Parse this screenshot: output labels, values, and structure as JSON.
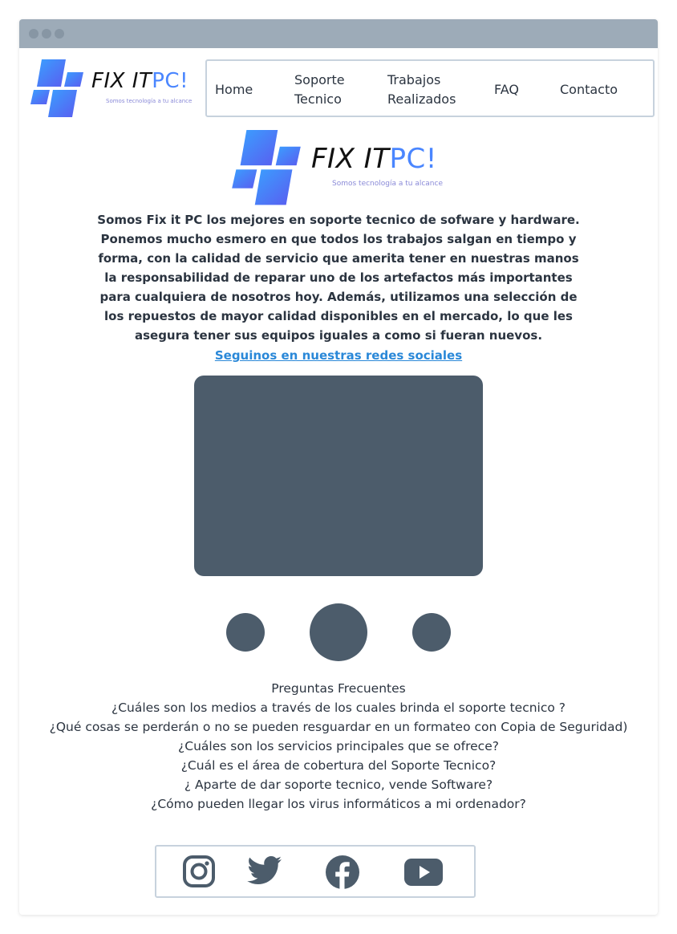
{
  "brand": {
    "name_main": "FIX IT",
    "name_accent": "PC!",
    "tagline": "Somos tecnología a tu alcance"
  },
  "nav": {
    "items": [
      {
        "label": "Home"
      },
      {
        "label": "Soporte\nTecnico"
      },
      {
        "label": "Trabajos\nRealizados"
      },
      {
        "label": "FAQ"
      },
      {
        "label": "Contacto"
      }
    ]
  },
  "about": {
    "text": "Somos Fix it PC los mejores en soporte tecnico de sofware y hardware. Ponemos mucho esmero en que todos los trabajos salgan en tiempo y forma, con la calidad de servicio que amerita tener en nuestras manos la responsabilidad de reparar uno de los artefactos más importantes para cualquiera de nosotros hoy. Además, utilizamos una selección de los repuestos de mayor calidad disponibles en el mercado, lo que les asegura tener sus equipos iguales a como si fueran nuevos.",
    "social_link": "Seguinos en nuestras redes sociales"
  },
  "faq": {
    "title": "Preguntas Frecuentes",
    "questions": [
      "¿Cuáles son los medios a través de los cuales brinda el soporte tecnico ?",
      "¿Qué cosas se perderán o no se pueden resguardar en un formateo con Copia de Seguridad)",
      "¿Cuáles son los servicios principales que se ofrece?",
      "¿Cuál es el área de cobertura del Soporte Tecnico?",
      "¿ Aparte de dar soporte tecnico, vende Software?",
      "¿Cómo pueden llegar los virus informáticos a mi ordenador?"
    ]
  },
  "social": {
    "icons": [
      "instagram-icon",
      "twitter-icon",
      "facebook-icon",
      "youtube-icon"
    ]
  },
  "colors": {
    "titlebar": "#9dabb8",
    "media": "#4c5c6b",
    "link": "#2a88d8",
    "logo_gradient_start": "#3aa0ff",
    "logo_gradient_end": "#5a5cf0",
    "border": "#c7d2dd"
  }
}
